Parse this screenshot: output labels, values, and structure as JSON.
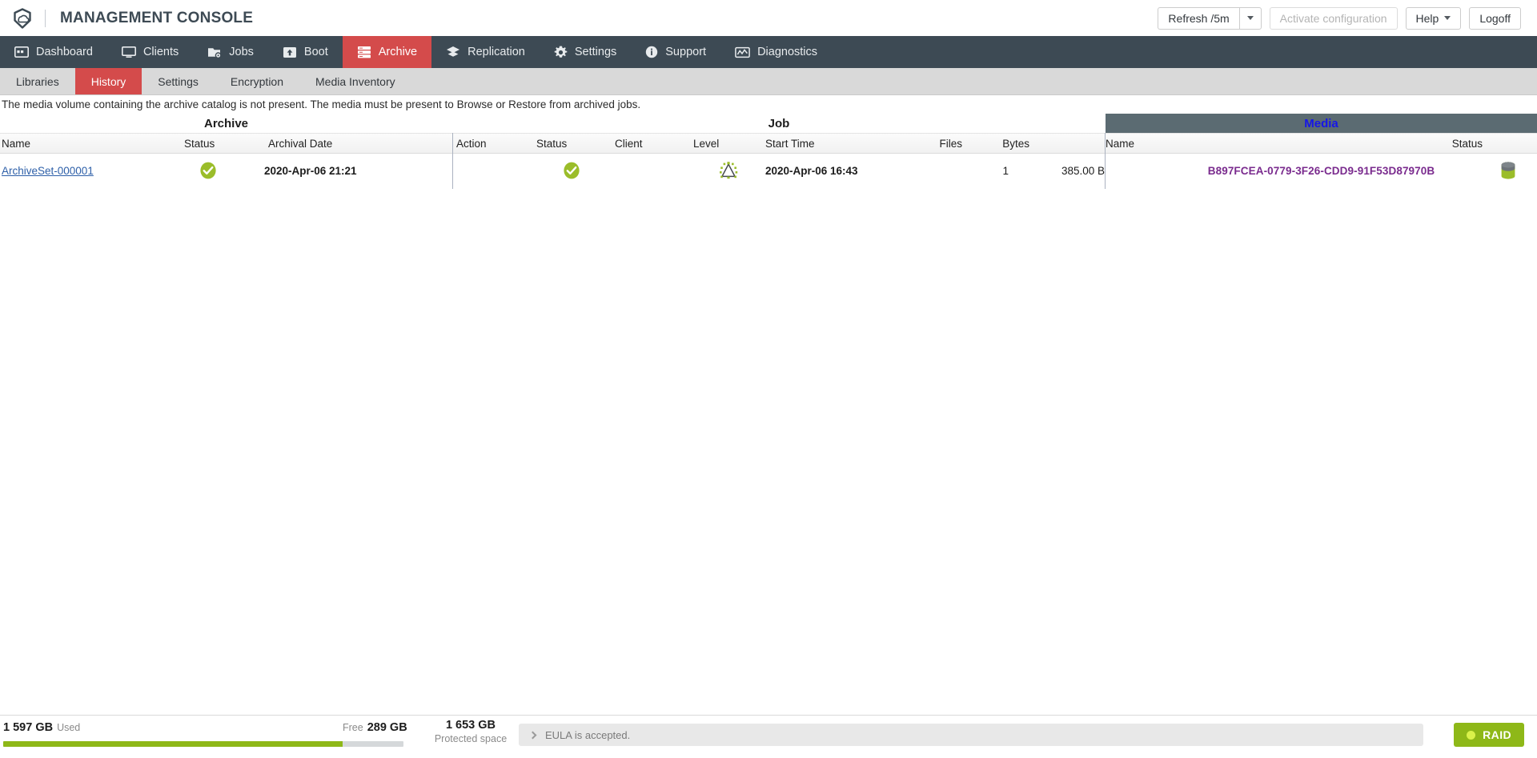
{
  "header": {
    "logo_icon": "cloud-shield-logo",
    "title": "MANAGEMENT CONSOLE",
    "refresh_label": "Refresh /5m",
    "activate_label": "Activate configuration",
    "help_label": "Help",
    "logoff_label": "Logoff"
  },
  "main_nav": {
    "items": [
      {
        "id": "dashboard",
        "label": "Dashboard",
        "icon": "dashboard-icon",
        "active": false
      },
      {
        "id": "clients",
        "label": "Clients",
        "icon": "monitor-icon",
        "active": false
      },
      {
        "id": "jobs",
        "label": "Jobs",
        "icon": "jobs-icon",
        "active": false
      },
      {
        "id": "boot",
        "label": "Boot",
        "icon": "boot-upload-icon",
        "active": false
      },
      {
        "id": "archive",
        "label": "Archive",
        "icon": "archive-rack-icon",
        "active": true
      },
      {
        "id": "replication",
        "label": "Replication",
        "icon": "layers-icon",
        "active": false
      },
      {
        "id": "settings",
        "label": "Settings",
        "icon": "gear-icon",
        "active": false
      },
      {
        "id": "support",
        "label": "Support",
        "icon": "info-icon",
        "active": false
      },
      {
        "id": "diagnostics",
        "label": "Diagnostics",
        "icon": "diagnostics-icon",
        "active": false
      }
    ]
  },
  "sub_nav": {
    "items": [
      {
        "id": "libraries",
        "label": "Libraries",
        "active": false
      },
      {
        "id": "history",
        "label": "History",
        "active": true
      },
      {
        "id": "settings",
        "label": "Settings",
        "active": false
      },
      {
        "id": "encryption",
        "label": "Encryption",
        "active": false
      },
      {
        "id": "media-inventory",
        "label": "Media Inventory",
        "active": false
      }
    ]
  },
  "notice": {
    "text": "The media volume containing the archive catalog is not present. The media must be present to Browse or Restore from archived jobs."
  },
  "table": {
    "groups": [
      {
        "id": "archive",
        "label": "Archive"
      },
      {
        "id": "job",
        "label": "Job"
      },
      {
        "id": "media",
        "label": "Media"
      }
    ],
    "columns": [
      {
        "id": "archive-name",
        "label": "Name"
      },
      {
        "id": "archive-status",
        "label": "Status"
      },
      {
        "id": "archival-date",
        "label": "Archival Date"
      },
      {
        "id": "job-action",
        "label": "Action"
      },
      {
        "id": "job-status",
        "label": "Status"
      },
      {
        "id": "job-client",
        "label": "Client"
      },
      {
        "id": "job-level",
        "label": "Level"
      },
      {
        "id": "job-start-time",
        "label": "Start Time"
      },
      {
        "id": "job-files",
        "label": "Files"
      },
      {
        "id": "job-bytes",
        "label": "Bytes"
      },
      {
        "id": "media-name",
        "label": "Name"
      },
      {
        "id": "media-status",
        "label": "Status"
      }
    ],
    "rows": [
      {
        "archive_name": "ArchiveSet-000001",
        "archive_status_icon": "status-ok-check-icon",
        "archival_date": "2020-Apr-06 21:21",
        "job_action": "",
        "job_status_icon": "status-ok-check-icon",
        "job_client": "",
        "job_level_icon": "backup-level-full-icon",
        "job_start_time": "2020-Apr-06 16:43",
        "job_files": "1",
        "job_bytes": "385.00 B",
        "media_name": "B897FCEA-0779-3F26-CDD9-91F53D87970B",
        "media_status_icon": "tape-cartridge-icon"
      }
    ]
  },
  "footer": {
    "used_value": "1 597 GB",
    "used_label": "Used",
    "free_label": "Free",
    "free_value": "289 GB",
    "protected_value": "1 653 GB",
    "protected_label": "Protected space",
    "bar_fill_percent": 84.7,
    "eula_text": "EULA is accepted.",
    "raid_label": "RAID"
  },
  "colors": {
    "nav_bg": "#3d4a54",
    "accent_red": "#d44b4b",
    "accent_green": "#8eb818",
    "media_header_bg": "#5b6b72",
    "media_header_text": "#1616e8",
    "link_blue": "#2d5fa8",
    "link_purple": "#7a2b8e"
  }
}
